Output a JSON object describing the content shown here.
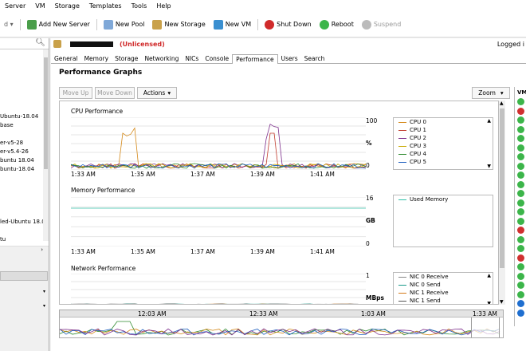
{
  "menu": [
    "Server",
    "VM",
    "Storage",
    "Templates",
    "Tools",
    "Help"
  ],
  "toolbar": {
    "add_server": "Add New Server",
    "new_pool": "New Pool",
    "new_storage": "New Storage",
    "new_vm": "New VM",
    "shut_down": "Shut Down",
    "reboot": "Reboot",
    "suspend": "Suspend"
  },
  "tree": [
    "Ubuntu-18.04",
    "base",
    "er-v5-28",
    "er-v5.4-26",
    "buntu 18.04",
    "buntu-18.04",
    "led-Ubuntu 18.0",
    "tu"
  ],
  "header": {
    "unlicensed": "(Unlicensed)",
    "logged": "Logged i"
  },
  "tabs": [
    "General",
    "Memory",
    "Storage",
    "Networking",
    "NICs",
    "Console",
    "Performance",
    "Users",
    "Search"
  ],
  "page_title": "Performance Graphs",
  "buttons": {
    "move_up": "Move Up",
    "move_down": "Move Down",
    "actions": "Actions",
    "zoom": "Zoom"
  },
  "cpu": {
    "title": "CPU Performance",
    "ymax": "100",
    "unit": "%",
    "ymin": "0",
    "times": [
      "1:33 AM",
      "1:35 AM",
      "1:37 AM",
      "1:39 AM",
      "1:41 AM"
    ],
    "legend": [
      {
        "name": "CPU 0",
        "color": "#d4891a"
      },
      {
        "name": "CPU 1",
        "color": "#c0392b"
      },
      {
        "name": "CPU 2",
        "color": "#7d2e8c"
      },
      {
        "name": "CPU 3",
        "color": "#c8a800"
      },
      {
        "name": "CPU 4",
        "color": "#2e8b2e"
      },
      {
        "name": "CPU 5",
        "color": "#1f5fbf"
      }
    ]
  },
  "memory": {
    "title": "Memory Performance",
    "ymax": "16",
    "unit": "GB",
    "ymin": "0",
    "times": [
      "1:33 AM",
      "1:35 AM",
      "1:37 AM",
      "1:39 AM",
      "1:41 AM"
    ],
    "legend": [
      {
        "name": "Used Memory",
        "color": "#2fbfa8"
      }
    ]
  },
  "network": {
    "title": "Network Performance",
    "ymax": "1",
    "unit": "MBps",
    "legend": [
      {
        "name": "NIC 0 Receive",
        "color": "#888"
      },
      {
        "name": "NIC 0 Send",
        "color": "#1a9a8a"
      },
      {
        "name": "NIC 1 Receive",
        "color": "#d47a1a"
      },
      {
        "name": "NIC 1 Send",
        "color": "#555"
      }
    ]
  },
  "timeline": [
    "12:03 AM",
    "12:33 AM",
    "1:03 AM",
    "1:33 AM"
  ],
  "vm_header": "VM",
  "vm_status": [
    "#3cb54a",
    "#d03030",
    "#3cb54a",
    "#3cb54a",
    "#3cb54a",
    "#3cb54a",
    "#3cb54a",
    "#3cb54a",
    "#3cb54a",
    "#3cb54a",
    "#3cb54a",
    "#3cb54a",
    "#3cb54a",
    "#3cb54a",
    "#d03030",
    "#3cb54a",
    "#3cb54a",
    "#d03030",
    "#3cb54a",
    "#3cb54a",
    "#3cb54a",
    "#3cb54a",
    "#1f6fd0",
    "#1f6fd0"
  ]
}
